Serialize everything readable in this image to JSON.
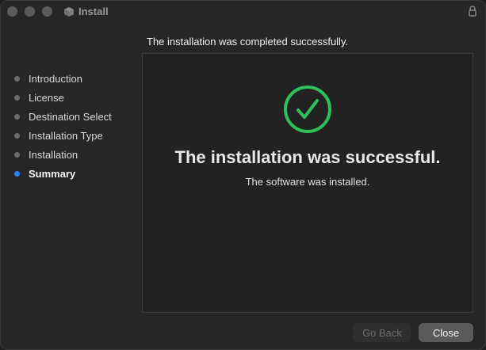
{
  "window": {
    "title": "Install",
    "icons": {
      "package": "package-icon",
      "lock": "lock-icon"
    }
  },
  "header": {
    "text": "The installation was completed successfully."
  },
  "sidebar": {
    "items": [
      {
        "label": "Introduction",
        "active": false
      },
      {
        "label": "License",
        "active": false
      },
      {
        "label": "Destination Select",
        "active": false
      },
      {
        "label": "Installation Type",
        "active": false
      },
      {
        "label": "Installation",
        "active": false
      },
      {
        "label": "Summary",
        "active": true
      }
    ]
  },
  "main": {
    "icon": "checkmark-circle-icon",
    "title": "The installation was successful.",
    "subtitle": "The software was installed."
  },
  "buttons": {
    "back_label": "Go Back",
    "close_label": "Close"
  },
  "colors": {
    "accent_active": "#2f7cf6",
    "success_green": "#2fbf58"
  }
}
